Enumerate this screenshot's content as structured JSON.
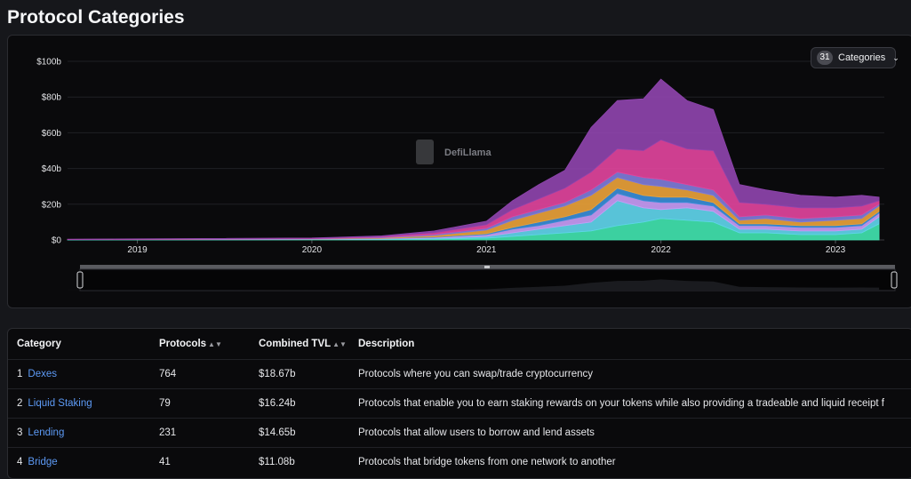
{
  "page_title": "Protocol Categories",
  "dropdown": {
    "count": "31",
    "label": "Categories",
    "chevron_icon": "chevron-down-icon"
  },
  "watermark": "DefiLlama",
  "chart_data": {
    "type": "area",
    "title": "",
    "xlabel": "",
    "ylabel": "",
    "x_ticks": [
      "2019",
      "2020",
      "2021",
      "2022",
      "2023"
    ],
    "y_ticks": [
      "$0",
      "$20b",
      "$40b",
      "$60b",
      "$80b",
      "$100b"
    ],
    "ylim": [
      0,
      100
    ],
    "x_range": [
      "2018-07",
      "2023-04"
    ],
    "stacked": true,
    "x": [
      2018.6,
      2020.0,
      2020.4,
      2020.7,
      2021.0,
      2021.15,
      2021.3,
      2021.45,
      2021.6,
      2021.75,
      2021.9,
      2022.0,
      2022.15,
      2022.3,
      2022.45,
      2022.6,
      2022.8,
      2023.0,
      2023.15,
      2023.25
    ],
    "series": [
      {
        "color": "#41e2ae",
        "values": [
          0.1,
          0.2,
          0.3,
          0.5,
          1,
          2,
          3,
          4,
          5,
          8,
          10,
          12,
          11,
          10,
          4,
          4,
          3,
          3,
          4,
          9
        ]
      },
      {
        "color": "#5fd4ea",
        "values": [
          0.1,
          0.2,
          0.3,
          0.5,
          1,
          2,
          3,
          4,
          5,
          14,
          8,
          5,
          7,
          6,
          2,
          2,
          2,
          2,
          2,
          4
        ]
      },
      {
        "color": "#c79bf5",
        "values": [
          0,
          0.1,
          0.2,
          0.4,
          1,
          2,
          2,
          3,
          4,
          4,
          4,
          4,
          3,
          3,
          2,
          2,
          2,
          2,
          2,
          2
        ]
      },
      {
        "color": "#3a8dd8",
        "values": [
          0,
          0,
          0.1,
          0.3,
          0.5,
          1,
          2,
          2,
          3,
          3,
          3,
          3,
          3,
          2,
          1,
          1,
          1,
          1,
          1,
          1
        ]
      },
      {
        "color": "#e8a13a",
        "values": [
          0,
          0.1,
          0.3,
          0.8,
          2,
          4,
          5,
          6,
          8,
          6,
          6,
          6,
          4,
          4,
          2,
          3,
          2,
          3,
          3,
          3
        ]
      },
      {
        "color": "#7e7cd9",
        "values": [
          0,
          0.1,
          0.3,
          0.6,
          1,
          2,
          2,
          2,
          3,
          3,
          4,
          4,
          3,
          3,
          2,
          2,
          2,
          2,
          2,
          1
        ]
      },
      {
        "color": "#e0449c",
        "values": [
          0.1,
          0.2,
          0.4,
          1,
          2,
          4,
          6,
          8,
          10,
          13,
          15,
          22,
          20,
          22,
          8,
          6,
          6,
          5,
          5,
          2
        ]
      },
      {
        "color": "#8e44ad",
        "values": [
          0.1,
          0.2,
          0.4,
          0.9,
          2,
          5,
          8,
          10,
          25,
          27,
          29,
          34,
          27,
          23,
          10,
          8,
          7,
          6,
          6,
          2
        ]
      }
    ]
  },
  "table": {
    "headers": [
      "Category",
      "Protocols",
      "Combined TVL",
      "Description"
    ],
    "rows": [
      {
        "rank": "1",
        "name": "Dexes",
        "protocols": "764",
        "tvl": "$18.67b",
        "description": "Protocols where you can swap/trade cryptocurrency"
      },
      {
        "rank": "2",
        "name": "Liquid Staking",
        "protocols": "79",
        "tvl": "$16.24b",
        "description": "Protocols that enable you to earn staking rewards on your tokens while also providing a tradeable and liquid receipt f"
      },
      {
        "rank": "3",
        "name": "Lending",
        "protocols": "231",
        "tvl": "$14.65b",
        "description": "Protocols that allow users to borrow and lend assets"
      },
      {
        "rank": "4",
        "name": "Bridge",
        "protocols": "41",
        "tvl": "$11.08b",
        "description": "Protocols that bridge tokens from one network to another"
      }
    ]
  }
}
